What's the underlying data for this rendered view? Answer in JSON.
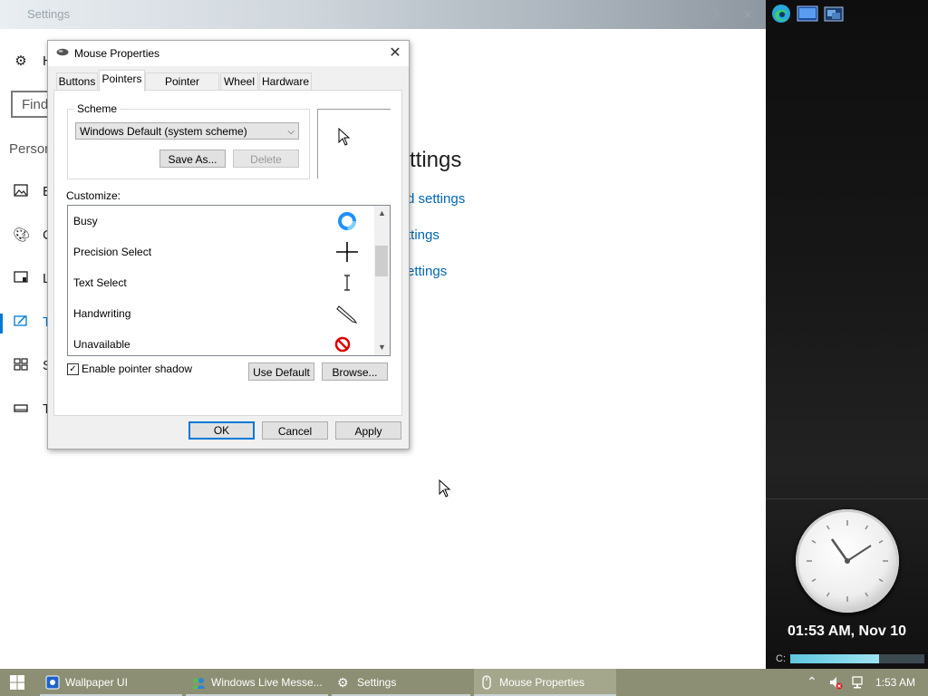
{
  "settings": {
    "title": "Settings",
    "home_letter": "H",
    "search_placeholder": "Find",
    "section_label": "Person",
    "nav_letters": [
      "B",
      "C",
      "L",
      "T",
      "S",
      "T"
    ],
    "heading": "ttings",
    "links": [
      "d settings",
      "ttings",
      "ettings"
    ]
  },
  "dialog": {
    "title": "Mouse Properties",
    "tabs": [
      "Buttons",
      "Pointers",
      "Pointer Options",
      "Wheel",
      "Hardware"
    ],
    "active_tab": "Pointers",
    "scheme_label": "Scheme",
    "scheme_value": "Windows Default (system scheme)",
    "save_as": "Save As...",
    "delete": "Delete",
    "customize_label": "Customize:",
    "pointers": [
      {
        "label": "Busy",
        "icon": "busy-icon"
      },
      {
        "label": "Precision Select",
        "icon": "crosshair-icon"
      },
      {
        "label": "Text Select",
        "icon": "text-select-icon"
      },
      {
        "label": "Handwriting",
        "icon": "pen-icon"
      },
      {
        "label": "Unavailable",
        "icon": "unavailable-icon"
      }
    ],
    "shadow_label": "Enable pointer shadow",
    "shadow_checked": true,
    "use_default": "Use Default",
    "browse": "Browse...",
    "ok": "OK",
    "cancel": "Cancel",
    "apply": "Apply"
  },
  "sidebar": {
    "clock_text": "01:53 AM, Nov 10",
    "drive_label": "C:",
    "drive_usage": 0.66
  },
  "taskbar": {
    "items": [
      {
        "label": "Wallpaper UI",
        "icon": "wallpaper-ui-icon"
      },
      {
        "label": "Windows Live Messe...",
        "icon": "messenger-icon"
      },
      {
        "label": "Settings",
        "icon": "gear-icon"
      },
      {
        "label": "Mouse Properties",
        "icon": "mouse-icon"
      }
    ],
    "active_item": "Mouse Properties",
    "time": "1:53 AM"
  },
  "colors": {
    "accent": "#0078d4",
    "link": "#0067b8",
    "taskbar": "#8d8f74"
  }
}
